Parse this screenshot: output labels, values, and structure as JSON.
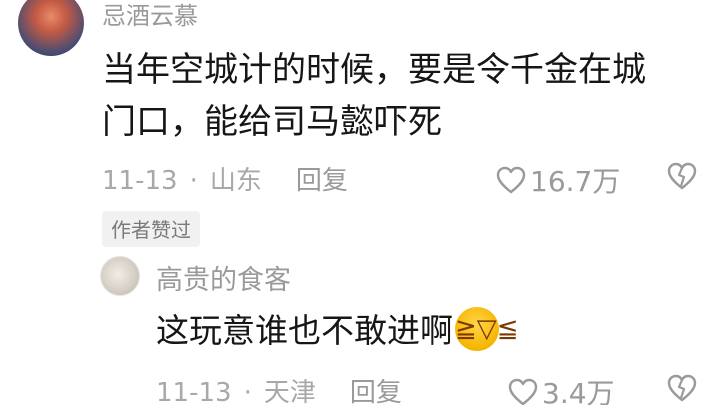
{
  "comment": {
    "username": "忌酒云慕",
    "text_line1": "当年空城计的时候，要是令千金在城",
    "text_line2": "门口，能给司马懿吓死",
    "date": "11-13",
    "separator": "·",
    "location": "山东",
    "reply_label": "回复",
    "likes": "16.7万",
    "author_liked_badge": "作者赞过"
  },
  "reply": {
    "username": "高贵的食客",
    "text": "这玩意谁也不敢进啊",
    "emoji": "laughing-crying-emoji",
    "date": "11-13",
    "separator": "·",
    "location": "天津",
    "reply_label": "回复",
    "likes": "3.4万"
  },
  "colors": {
    "text_primary": "#161616",
    "text_secondary": "#9a9a9a",
    "badge_bg": "#f1f1f1"
  }
}
